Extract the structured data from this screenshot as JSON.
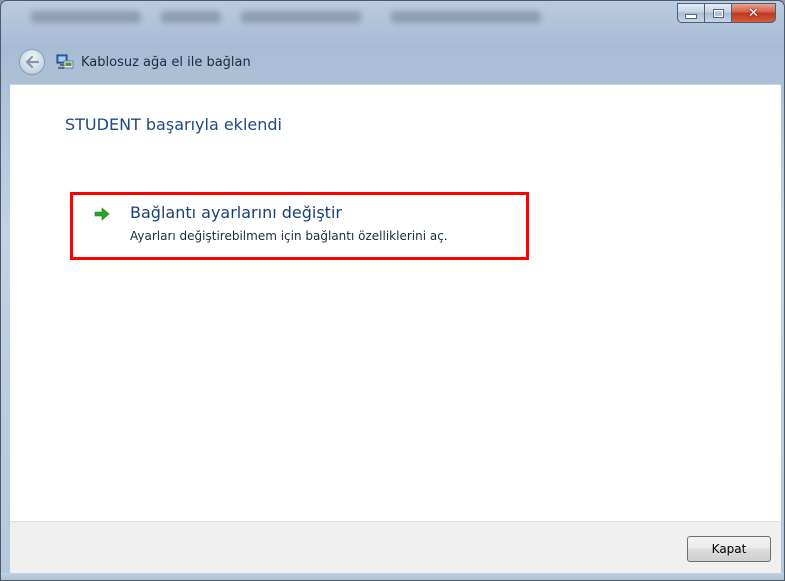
{
  "window": {
    "title": "Kablosuz ağa el ile bağlan",
    "caption_close_glyph": "✕"
  },
  "content": {
    "heading": "STUDENT başarıyla eklendi",
    "task": {
      "title": "Bağlantı ayarlarını değiştir",
      "description": "Ayarları değiştirebilmem için bağlantı özelliklerini aç."
    }
  },
  "footer": {
    "close_label": "Kapat"
  },
  "icons": {
    "back": "back-arrow-icon",
    "network": "network-computer-icon",
    "task_arrow": "green-arrow-icon"
  },
  "colors": {
    "heading": "#1f4a85",
    "highlight": "#ff0000",
    "task_arrow": "#2aa52a"
  }
}
